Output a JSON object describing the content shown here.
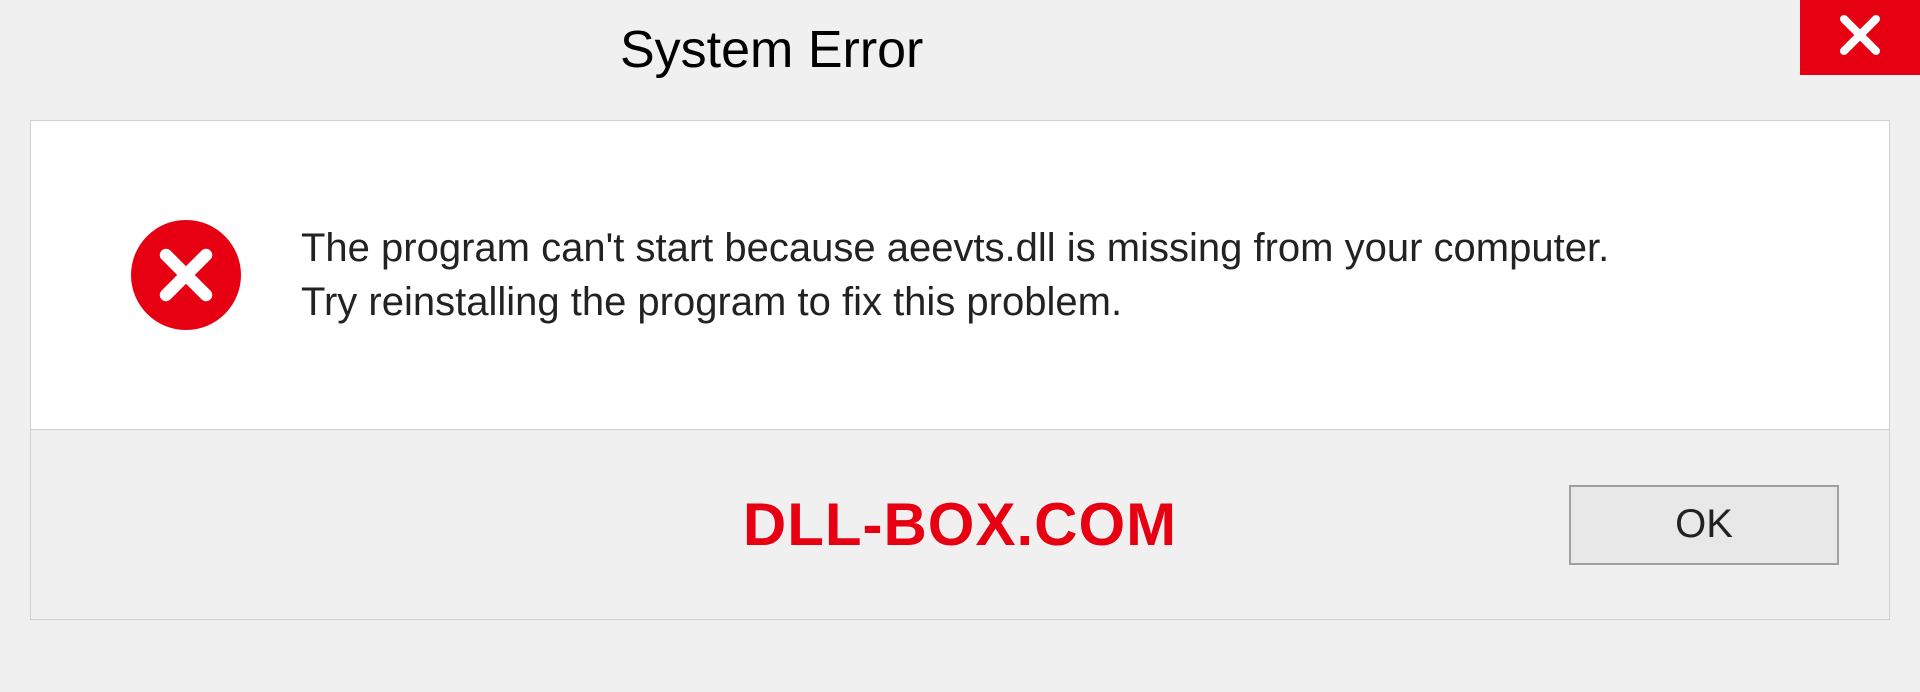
{
  "titlebar": {
    "title": "System Error"
  },
  "message": {
    "line1": "The program can't start because aeevts.dll is missing from your computer.",
    "line2": "Try reinstalling the program to fix this problem."
  },
  "footer": {
    "watermark": "DLL-BOX.COM",
    "ok_label": "OK"
  },
  "colors": {
    "accent_red": "#e60012"
  }
}
